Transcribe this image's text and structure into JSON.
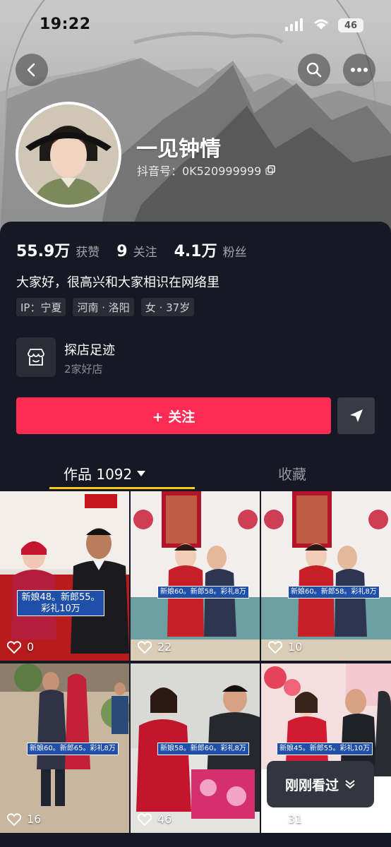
{
  "status": {
    "time": "19:22",
    "battery": "46"
  },
  "profile": {
    "nickname": "一见钟情",
    "douyin_id": "抖音号：0K520999999"
  },
  "stats": [
    {
      "value": "55.9万",
      "label": "获赞"
    },
    {
      "value": "9",
      "label": "关注"
    },
    {
      "value": "4.1万",
      "label": "粉丝"
    }
  ],
  "bio": "大家好，很高兴和大家相识在网络里",
  "tags": [
    "IP：宁夏",
    "河南 · 洛阳",
    "女 · 37岁"
  ],
  "shop": {
    "title": "探店足迹",
    "subtitle": "2家好店"
  },
  "actions": {
    "follow_label": "+ 关注"
  },
  "tabs": {
    "works": "作品 1092",
    "collection": "收藏"
  },
  "videos": [
    {
      "likes": "0",
      "caption": "新娘48。新郎55。彩礼10万"
    },
    {
      "likes": "22",
      "caption": "新娘60。新郎58。彩礼8万"
    },
    {
      "likes": "10",
      "caption": "新娘60。新郎58。彩礼8万"
    },
    {
      "likes": "16",
      "caption": "新娘60。新郎65。彩礼8万"
    },
    {
      "likes": "46",
      "caption": "新娘58。新郎60。彩礼8万"
    },
    {
      "likes": "31",
      "caption": "新娘45。新郎55。彩礼10万"
    }
  ],
  "recent_pill": "刚刚看过",
  "colors": {
    "accent": "#fe2c55",
    "background": "#161823",
    "tab_indicator": "#facc15"
  },
  "icons": [
    "back-icon",
    "search-icon",
    "more-icon",
    "copy-icon",
    "shop-icon",
    "share-icon",
    "heart-icon",
    "chevron-down-icon"
  ]
}
